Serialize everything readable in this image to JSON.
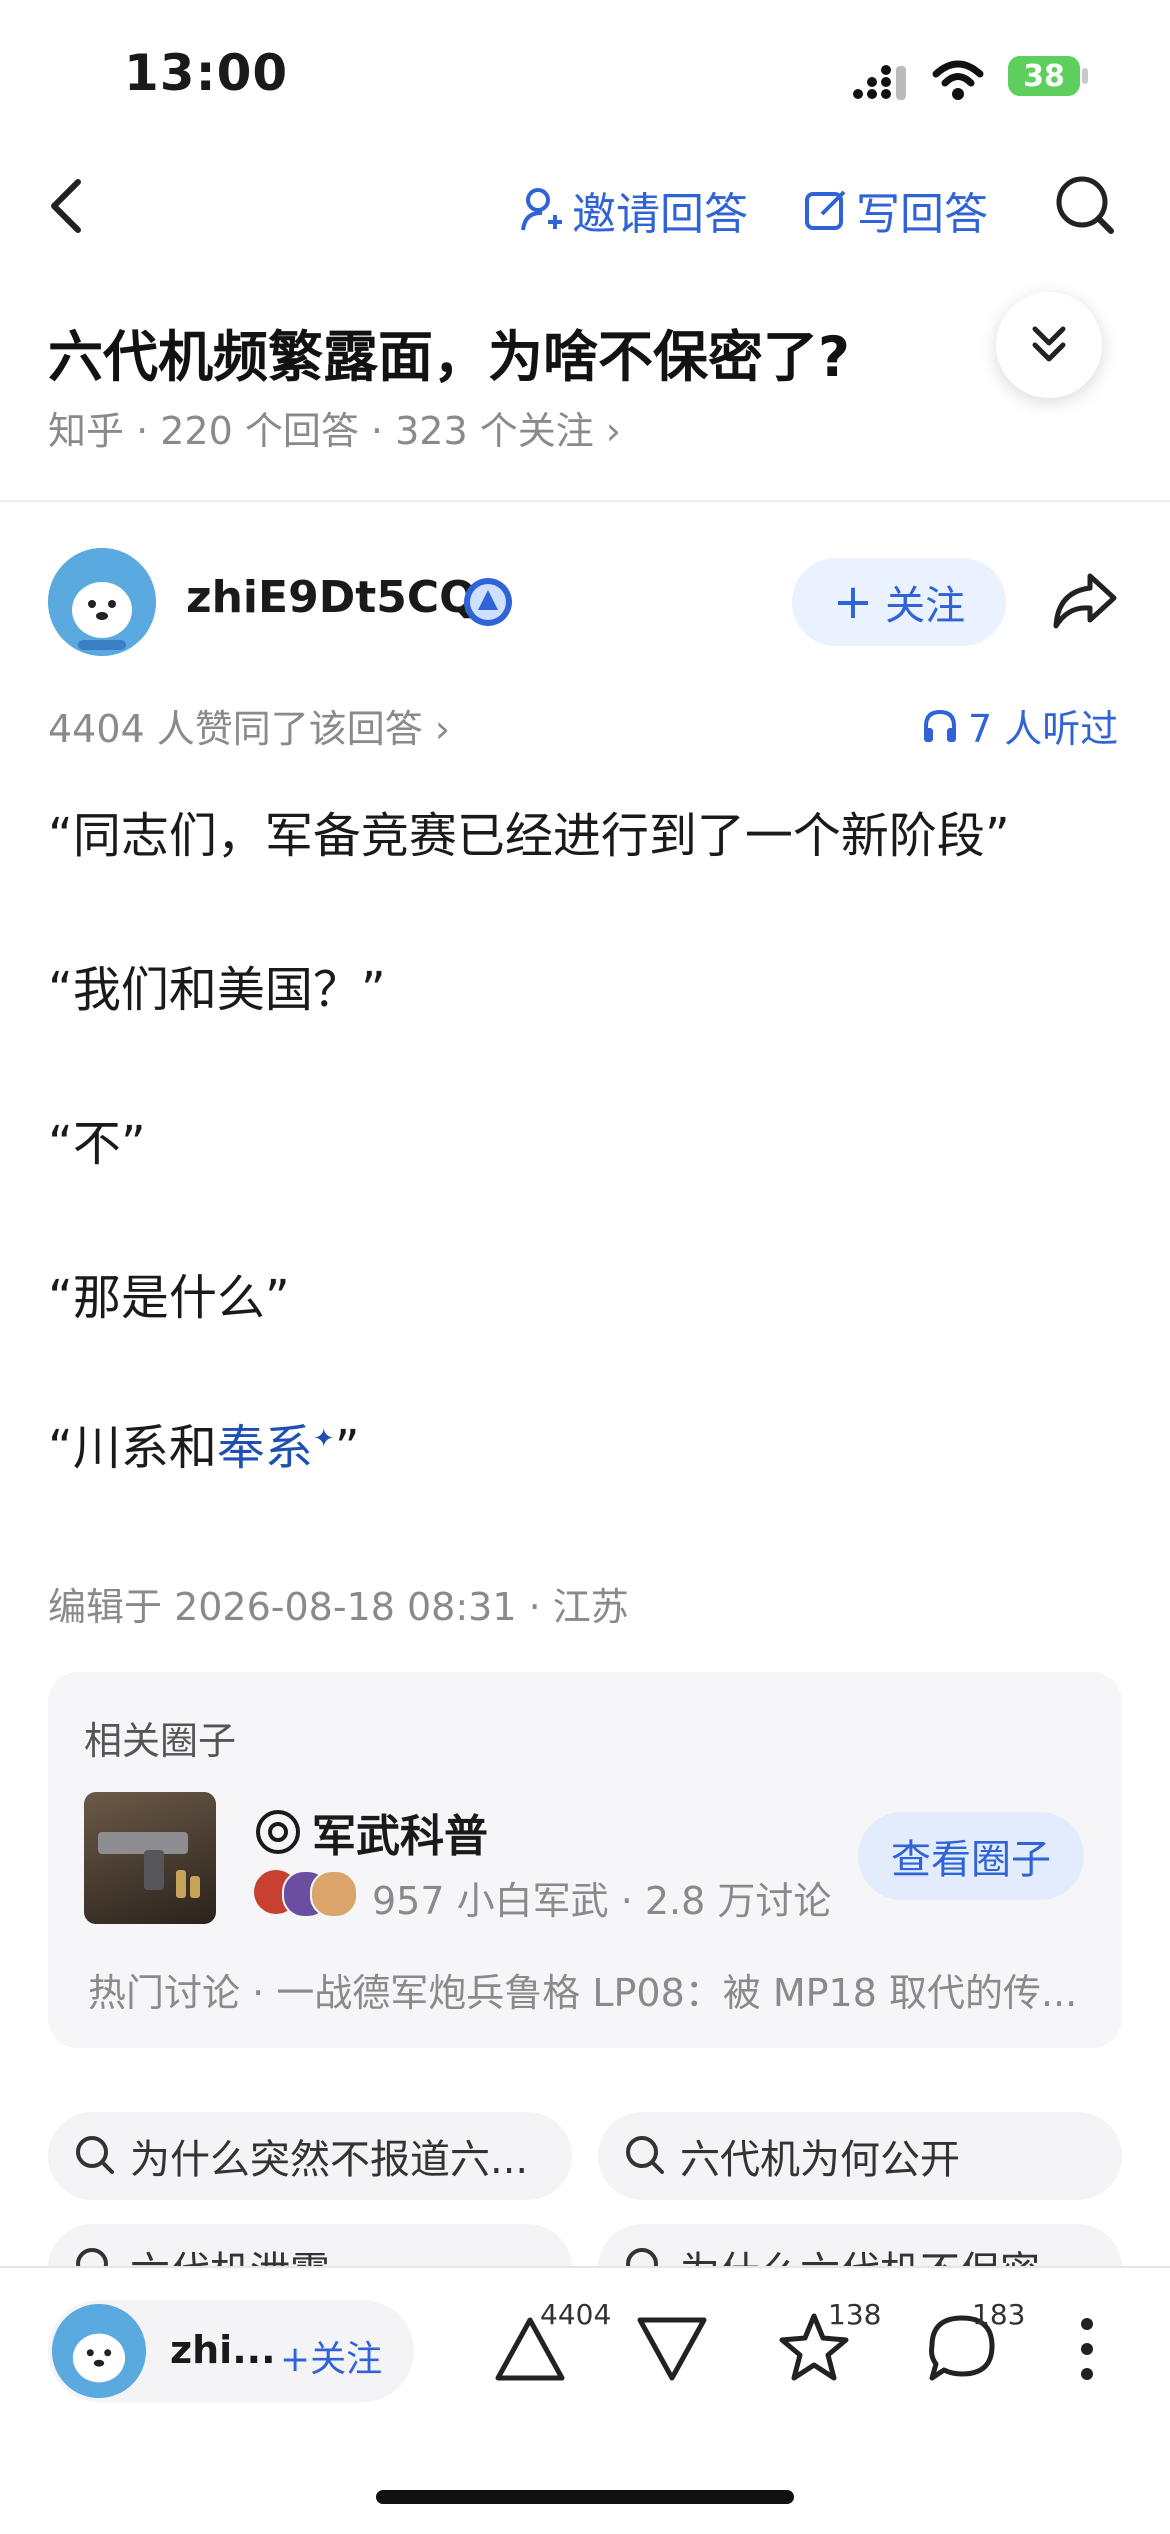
{
  "status_bar": {
    "time": "13:00",
    "battery": "38"
  },
  "nav": {
    "invite_label": "邀请回答",
    "write_label": "写回答"
  },
  "question": {
    "title": "六代机频繁露面，为啥不保密了?",
    "meta": "知乎 · 220 个回答 · 323 个关注 ›"
  },
  "answer": {
    "author": "zhiE9Dt5CQ",
    "follow_label": "关注",
    "likes_text": "4404 人赞同了该回答 ›",
    "listen_text": "7 人听过",
    "paragraphs": [
      "“同志们，军备竞赛已经进行到了一个新阶段”",
      "“我们和美国？”",
      "“不”",
      "“那是什么”"
    ],
    "last_para_prefix": "“川系和",
    "last_para_link": "奉系",
    "last_para_suffix": "”",
    "edited": "编辑于 2026-08-18 08:31 · 江苏"
  },
  "circle": {
    "section_label": "相关圈子",
    "name": "军武科普",
    "stats": "957 小白军武 · 2.8 万讨论",
    "button": "查看圈子",
    "hot": "热门讨论 · 一战德军炮兵鲁格 LP08：被 MP18 取代的传..."
  },
  "related_searches": [
    "为什么突然不报道六...",
    "六代机为何公开",
    "六代机泄露",
    "为什么六代机不保密"
  ],
  "bottom_bar": {
    "author_short": "zhi...",
    "follow_label": "+关注",
    "upvote_count": "4404",
    "favorite_count": "138",
    "comment_count": "183"
  }
}
